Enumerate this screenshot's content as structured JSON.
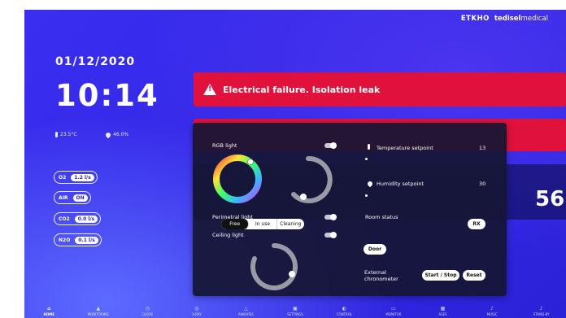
{
  "brand": {
    "part1": "ETKHO",
    "part2": "tedisel",
    "part3": "medical"
  },
  "date": "01/12/2020",
  "time": "10:14",
  "environment": {
    "temperature": "23.5°C",
    "humidity": "46.0%"
  },
  "gases": [
    {
      "name": "O2",
      "value": "1.2 l/s"
    },
    {
      "name": "AIR",
      "value": "ON"
    },
    {
      "name": "CO2",
      "value": "0.0 l/s"
    },
    {
      "name": "N2O",
      "value": "0.1 l/s"
    }
  ],
  "alerts": {
    "primary": "Electrical failure. Isolation leak"
  },
  "timer": {
    "seconds_visible": "56"
  },
  "lighting": {
    "rgb_label": "RGB light",
    "perimetral_label": "Perimetral light",
    "ceiling_label": "Ceiling light"
  },
  "climate": {
    "temperature_label": "Temperature setpoint",
    "temperature_value": "13",
    "humidity_label": "Humidity setpoint",
    "humidity_value": "30"
  },
  "room": {
    "status_label": "Room status",
    "options": [
      "Free",
      "In use",
      "Cleaning"
    ],
    "selected": "Free",
    "rx_label": "RX",
    "door_label": "Door"
  },
  "chronometer": {
    "label_line1": "External",
    "label_line2": "chronometer",
    "start_stop": "Start / Stop",
    "reset": "Reset"
  },
  "nav": [
    {
      "label": "HOME",
      "icon": "home-icon",
      "glyph": "⌂",
      "active": true
    },
    {
      "label": "MONITORING",
      "icon": "monitoring-icon",
      "glyph": "▲",
      "active": false
    },
    {
      "label": "CLOCK",
      "icon": "clock-icon",
      "glyph": "◷",
      "active": false
    },
    {
      "label": "X-RAY",
      "icon": "xray-icon",
      "glyph": "◎",
      "active": false
    },
    {
      "label": "ANALYSIS",
      "icon": "analysis-icon",
      "glyph": "△",
      "active": false
    },
    {
      "label": "SETTINGS",
      "icon": "settings-icon",
      "glyph": "▣",
      "active": false
    },
    {
      "label": "CONTROL",
      "icon": "control-icon",
      "glyph": "◐",
      "active": false
    },
    {
      "label": "MONITOR",
      "icon": "monitor-icon",
      "glyph": "▭",
      "active": false
    },
    {
      "label": "ASES",
      "icon": "ases-icon",
      "glyph": "▦",
      "active": false
    },
    {
      "label": "MUSIC",
      "icon": "music-icon",
      "glyph": "♪",
      "active": false
    },
    {
      "label": "STAND-BY",
      "icon": "standby-icon",
      "glyph": "♪",
      "active": false
    }
  ],
  "colors": {
    "background": "#3327e6",
    "alert": "#e0113b",
    "panel": "#16163a"
  }
}
